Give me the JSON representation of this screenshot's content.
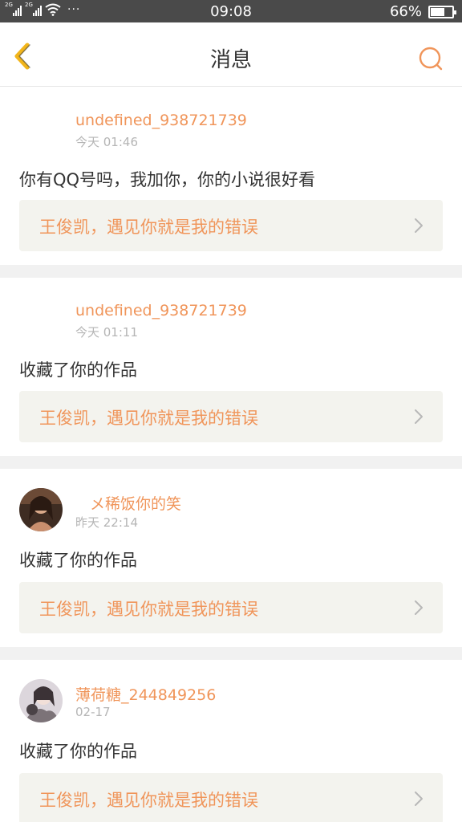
{
  "status_bar": {
    "network_1": "2G",
    "network_2": "2G",
    "more": "···",
    "time": "09:08",
    "battery": "66%",
    "battery_level": 0.66
  },
  "header": {
    "title": "消息",
    "back_icon": "chevron-left-icon",
    "search_icon": "search-icon"
  },
  "colors": {
    "accent": "#f0955a",
    "back_icon": "#f2b51b",
    "status_bar": "#4a4a4a",
    "card_bg": "#ffffff",
    "work_bg": "#f3f3ee"
  },
  "messages": [
    {
      "user": "undefined_938721739",
      "time": "今天 01:46",
      "text": "你有QQ号吗，我加你，你的小说很好看",
      "work_title": "王俊凯，遇见你就是我的错误",
      "has_avatar": false
    },
    {
      "user": "undefined_938721739",
      "time": "今天 01:11",
      "text": "收藏了你的作品",
      "work_title": "王俊凯，遇见你就是我的错误",
      "has_avatar": false
    },
    {
      "user": "メ稀饭你的笑",
      "time": "昨天 22:14",
      "text": "收藏了你的作品",
      "work_title": "王俊凯，遇见你就是我的错误",
      "has_avatar": true
    },
    {
      "user": "薄荷糖_244849256",
      "time": "02-17",
      "text": "收藏了你的作品",
      "work_title": "王俊凯，遇见你就是我的错误",
      "has_avatar": true
    }
  ]
}
